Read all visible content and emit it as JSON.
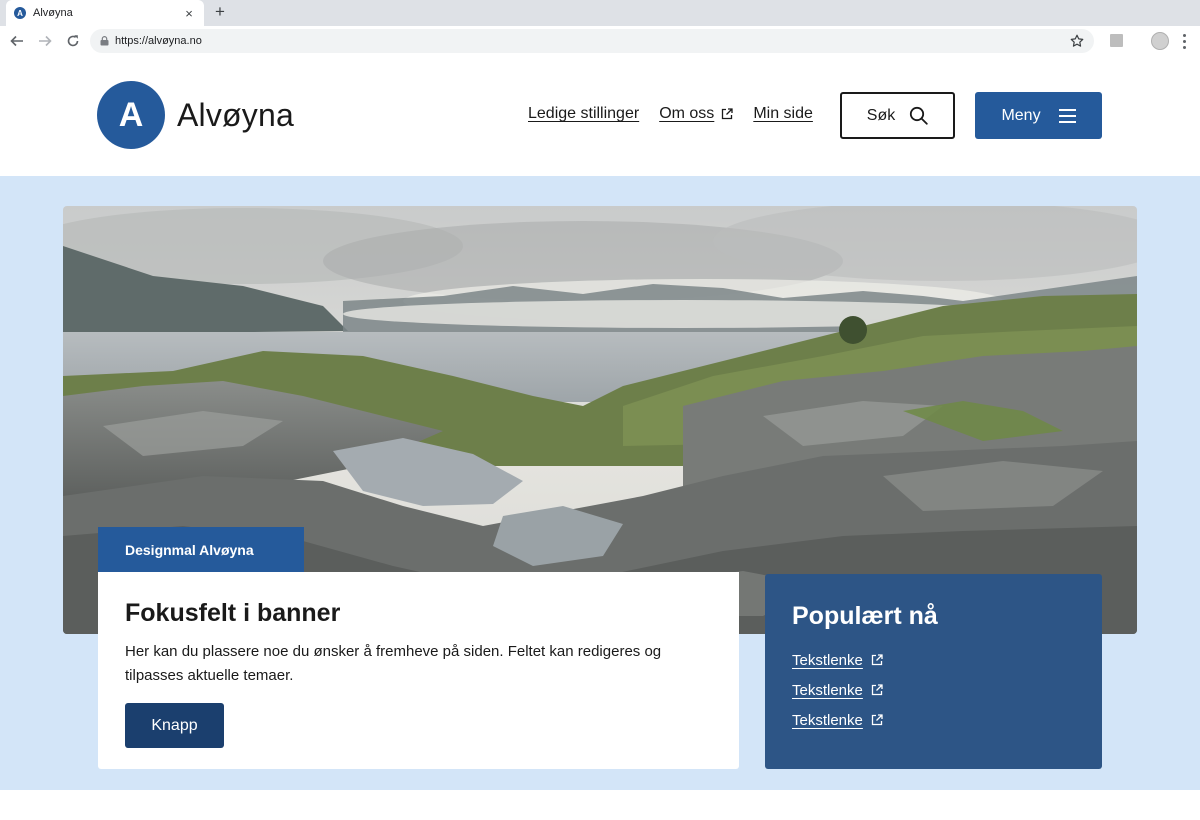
{
  "browser": {
    "tab_title": "Alvøyna",
    "tab_favicon_letter": "A",
    "tab_close": "×",
    "new_tab": "+",
    "url": "https://alvøyna.no"
  },
  "header": {
    "logo_letter": "A",
    "logo_text": "Alvøyna",
    "links": [
      {
        "label": "Ledige stillinger",
        "external": false
      },
      {
        "label": "Om oss",
        "external": true
      },
      {
        "label": "Min side",
        "external": false
      }
    ],
    "search_label": "Søk",
    "menu_label": "Meny"
  },
  "hero": {
    "tag": "Designmal Alvøyna",
    "focus": {
      "title": "Fokusfelt i banner",
      "text": "Her kan du plassere noe du ønsker å fremheve på siden. Feltet kan redigeres og tilpasses aktuelle temaer.",
      "button_label": "Knapp"
    },
    "popular": {
      "title": "Populært nå",
      "links": [
        {
          "label": "Tekstlenke",
          "external": true
        },
        {
          "label": "Tekstlenke",
          "external": true
        },
        {
          "label": "Tekstlenke",
          "external": true
        }
      ]
    }
  },
  "colors": {
    "brand_blue": "#255a9b",
    "hero_background": "#d3e5f8",
    "popular_background": "#2d5586",
    "button_dark": "#1b3f6e"
  },
  "icons": [
    "back-arrow-icon",
    "forward-arrow-icon",
    "reload-icon",
    "lock-icon",
    "star-icon",
    "extension-icon",
    "profile-icon",
    "kebab-menu-icon",
    "external-link-icon",
    "search-icon",
    "hamburger-icon"
  ]
}
